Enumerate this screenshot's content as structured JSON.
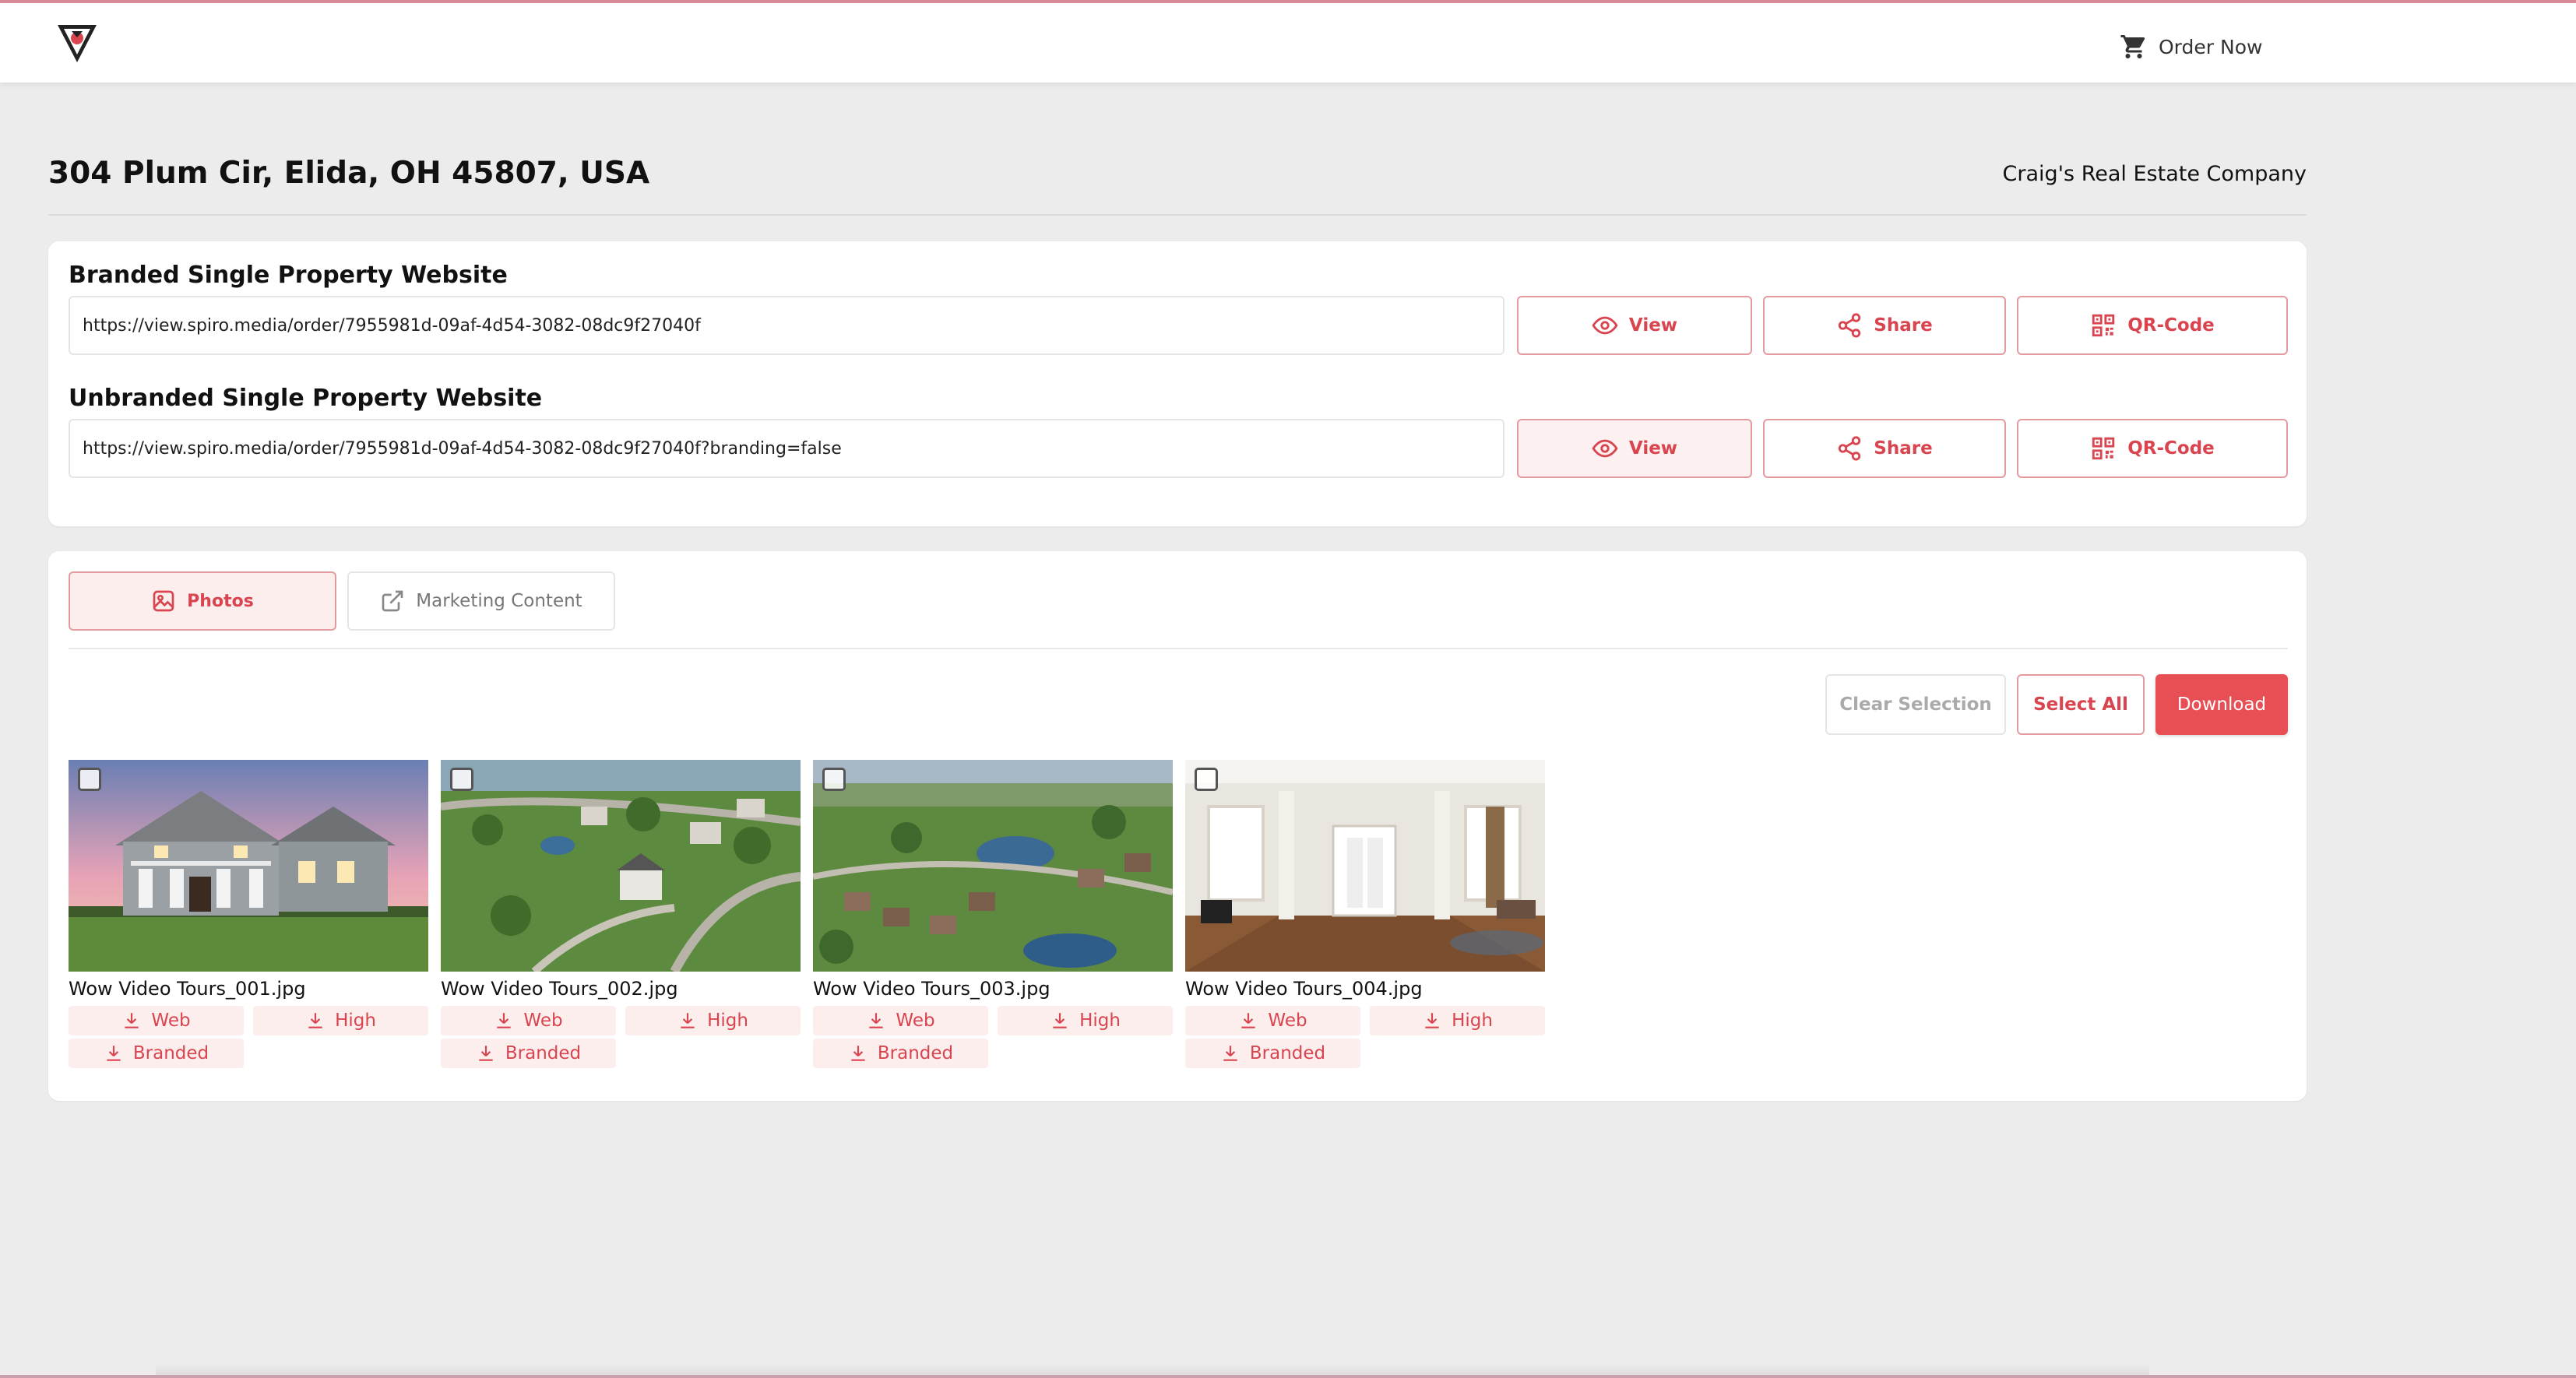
{
  "header": {
    "order_now": "Order Now"
  },
  "property": {
    "address": "304 Plum Cir, Elida, OH 45807, USA",
    "company": "Craig's Real Estate Company"
  },
  "websites": [
    {
      "title": "Branded Single Property Website",
      "url": "https://view.spiro.media/order/7955981d-09af-4d54-3082-08dc9f27040f",
      "view_label": "View",
      "share_label": "Share",
      "qr_label": "QR-Code"
    },
    {
      "title": "Unbranded Single Property Website",
      "url": "https://view.spiro.media/order/7955981d-09af-4d54-3082-08dc9f27040f?branding=false",
      "view_label": "View",
      "share_label": "Share",
      "qr_label": "QR-Code"
    }
  ],
  "tabs": [
    {
      "label": "Photos",
      "active": true
    },
    {
      "label": "Marketing Content",
      "active": false
    }
  ],
  "actions": {
    "clear_selection": "Clear Selection",
    "select_all": "Select All",
    "download": "Download"
  },
  "download_options": {
    "web": "Web",
    "high": "High",
    "branded": "Branded"
  },
  "photos": [
    {
      "filename": "Wow Video Tours_001.jpg"
    },
    {
      "filename": "Wow Video Tours_002.jpg"
    },
    {
      "filename": "Wow Video Tours_003.jpg"
    },
    {
      "filename": "Wow Video Tours_004.jpg"
    }
  ],
  "colors": {
    "accent": "#d9444f",
    "accent_fill": "#e84f55",
    "accent_soft": "#fdeeee",
    "page_bg": "#ececec"
  }
}
